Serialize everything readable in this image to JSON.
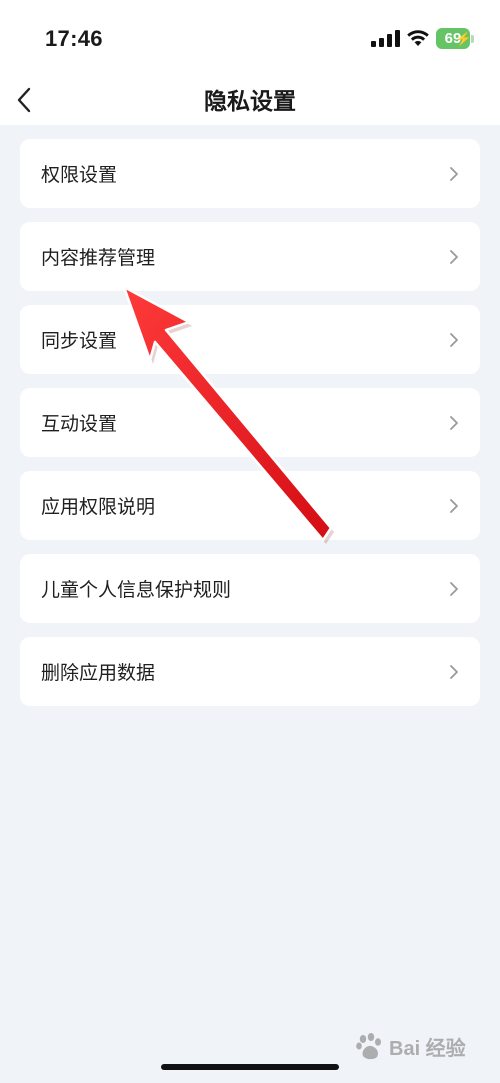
{
  "status_bar": {
    "time": "17:46",
    "battery_level": "69",
    "battery_color": "#65c466",
    "icons": [
      "signal-icon",
      "wifi-icon",
      "battery-icon"
    ]
  },
  "nav": {
    "title": "隐私设置",
    "back_icon": "chevron-left-icon"
  },
  "menu": {
    "items": [
      {
        "label": "权限设置"
      },
      {
        "label": "内容推荐管理"
      },
      {
        "label": "同步设置"
      },
      {
        "label": "互动设置"
      },
      {
        "label": "应用权限说明"
      },
      {
        "label": "儿童个人信息保护规则"
      },
      {
        "label": "删除应用数据"
      }
    ],
    "item_icon": "chevron-right-icon"
  },
  "annotation": {
    "arrow_color": "#e8141c",
    "points_to": "内容推荐管理"
  },
  "watermark": {
    "text": "Bai 经验"
  },
  "colors": {
    "background": "#f0f3f8",
    "card": "#ffffff"
  }
}
